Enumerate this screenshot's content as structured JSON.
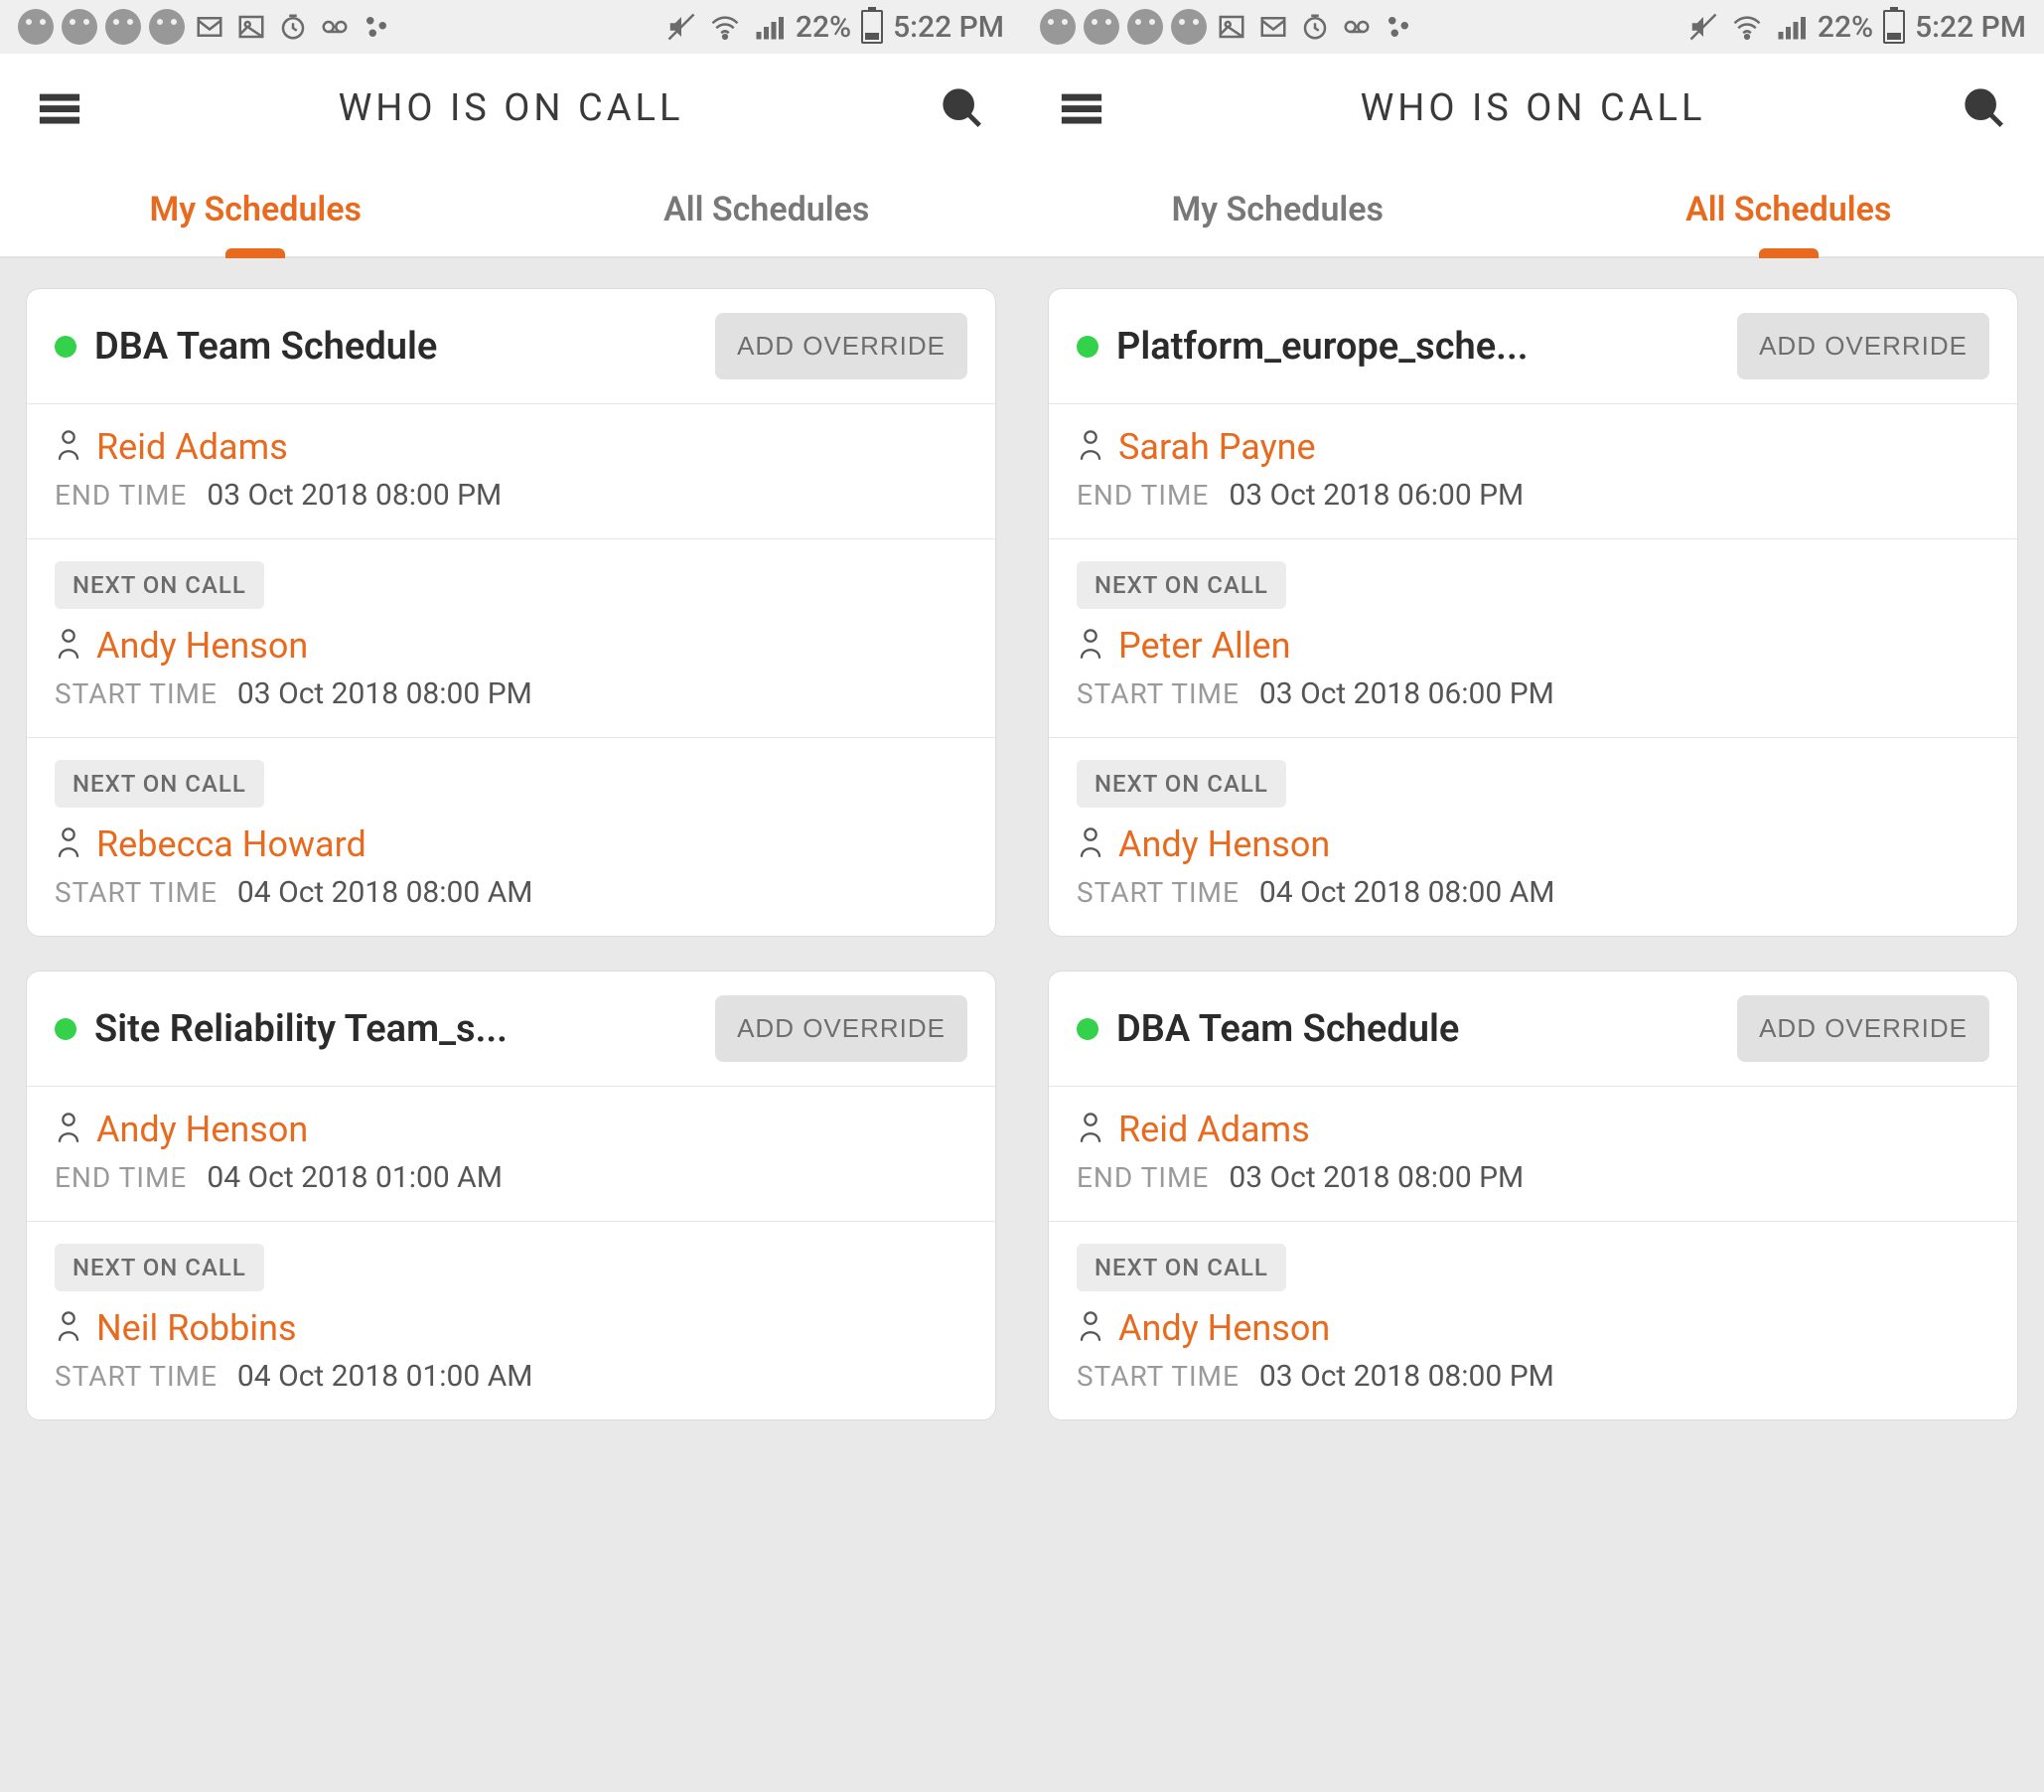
{
  "statusbar": {
    "battery_pct": "22%",
    "clock": "5:22 PM"
  },
  "header": {
    "title": "WHO IS ON CALL"
  },
  "tabs": {
    "my": "My Schedules",
    "all": "All Schedules"
  },
  "labels": {
    "add_override": "ADD OVERRIDE",
    "next_on_call": "NEXT ON CALL",
    "end_time": "END TIME",
    "start_time": "START TIME"
  },
  "left": {
    "active_tab": "my",
    "cards": [
      {
        "title": "DBA Team Schedule",
        "rows": [
          {
            "name": "Reid Adams",
            "time_label": "end_time",
            "time_value": "03 Oct 2018 08:00 PM"
          },
          {
            "badge": true,
            "name": "Andy Henson",
            "time_label": "start_time",
            "time_value": "03 Oct 2018 08:00 PM"
          },
          {
            "badge": true,
            "name": "Rebecca Howard",
            "time_label": "start_time",
            "time_value": "04 Oct 2018 08:00 AM"
          }
        ]
      },
      {
        "title": "Site Reliability Team_s...",
        "rows": [
          {
            "name": "Andy Henson",
            "time_label": "end_time",
            "time_value": "04 Oct 2018 01:00 AM"
          },
          {
            "badge": true,
            "name": "Neil Robbins",
            "time_label": "start_time",
            "time_value": "04 Oct 2018 01:00 AM"
          }
        ]
      }
    ]
  },
  "right": {
    "active_tab": "all",
    "cards": [
      {
        "title": "Platform_europe_sche...",
        "rows": [
          {
            "name": "Sarah Payne",
            "time_label": "end_time",
            "time_value": "03 Oct 2018 06:00 PM"
          },
          {
            "badge": true,
            "name": "Peter Allen",
            "time_label": "start_time",
            "time_value": "03 Oct 2018 06:00 PM"
          },
          {
            "badge": true,
            "name": "Andy Henson",
            "time_label": "start_time",
            "time_value": "04 Oct 2018 08:00 AM"
          }
        ]
      },
      {
        "title": "DBA Team Schedule",
        "rows": [
          {
            "name": "Reid Adams",
            "time_label": "end_time",
            "time_value": "03 Oct 2018 08:00 PM"
          },
          {
            "badge": true,
            "name": "Andy Henson",
            "time_label": "start_time",
            "time_value": "03 Oct 2018 08:00 PM"
          }
        ]
      }
    ]
  }
}
